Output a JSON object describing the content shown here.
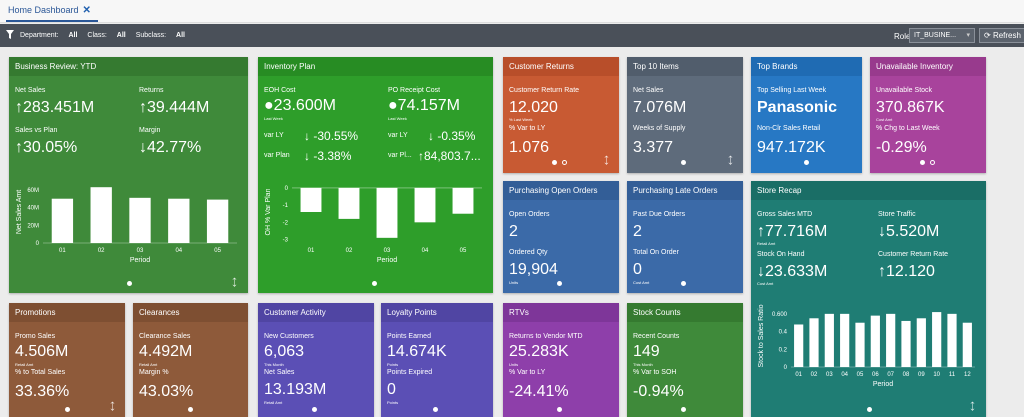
{
  "tabs": {
    "home": "Home Dashboard",
    "close": "✕"
  },
  "filters": {
    "department_label": "Department:",
    "department_value": "All",
    "class_label": "Class:",
    "class_value": "All",
    "subclass_label": "Subclass:",
    "subclass_value": "All",
    "role_label": "Role",
    "role_value": "IT_BUSINE...",
    "refresh_label": "Refresh"
  },
  "colors": {
    "green_dark": "#3f8a3a",
    "green_bright": "#2e9e2a",
    "orange": "#c85a33",
    "slate": "#5e6b7b",
    "blue": "#2778c4",
    "magenta": "#a8439c",
    "navy": "#3b6aa8",
    "teal": "#1f7d74",
    "brown": "#8e5a3a",
    "indigo": "#5b4fb5",
    "purple": "#8e3faa"
  },
  "business_review": {
    "title": "Business Review: YTD",
    "net_sales_label": "Net Sales",
    "net_sales_value": "283.451M",
    "returns_label": "Returns",
    "returns_value": "39.444M",
    "sales_vs_plan_label": "Sales vs Plan",
    "sales_vs_plan_value": "30.05%",
    "margin_label": "Margin",
    "margin_value": "42.77%"
  },
  "inventory_plan": {
    "title": "Inventory Plan",
    "eoh_label": "EOH Cost",
    "eoh_value": "23.600M",
    "eoh_sub": "Last Week",
    "po_label": "PO Receipt Cost",
    "po_value": "74.157M",
    "po_sub": "Last Week",
    "varly_label": "var LY",
    "varly_value": "-30.55%",
    "varly2_label": "var LY",
    "varly2_value": "-0.35%",
    "varplan_label": "var Plan",
    "varplan_value": "-3.38%",
    "varpl2_label": "var Pl...",
    "varpl2_value": "84,803.7..."
  },
  "customer_returns": {
    "title": "Customer Returns",
    "rate_label": "Customer Return Rate",
    "rate_value": "12.020",
    "rate_sub": "% Last Week",
    "var_label": "% Var to LY",
    "var_value": "1.076"
  },
  "top10": {
    "title": "Top 10 Items",
    "net_sales_label": "Net Sales",
    "net_sales_value": "7.076M",
    "weeks_label": "Weeks of Supply",
    "weeks_value": "3.377"
  },
  "top_brands": {
    "title": "Top Brands",
    "top_label": "Top Selling Last Week",
    "top_value": "Panasonic",
    "nonclr_label": "Non-Clr Sales Retail",
    "nonclr_value": "947.172K"
  },
  "unavailable": {
    "title": "Unavailable Inventory",
    "stock_label": "Unavailable Stock",
    "stock_value": "370.867K",
    "stock_sub": "Cost Amt",
    "chg_label": "% Chg to Last Week",
    "chg_value": "-0.29%"
  },
  "open_orders": {
    "title": "Purchasing Open Orders",
    "open_label": "Open Orders",
    "open_value": "2",
    "qty_label": "Ordered Qty",
    "qty_value": "19,904",
    "qty_sub": "Units"
  },
  "late_orders": {
    "title": "Purchasing Late Orders",
    "past_label": "Past Due Orders",
    "past_value": "2",
    "total_label": "Total On Order",
    "total_value": "0",
    "total_sub": "Cost Amt"
  },
  "store_recap": {
    "title": "Store Recap",
    "gross_label": "Gross Sales MTD",
    "gross_value": "77.716M",
    "gross_sub": "Retail Amt",
    "traffic_label": "Store Traffic",
    "traffic_value": "5.520M",
    "soh_label": "Stock On Hand",
    "soh_value": "23.633M",
    "soh_sub": "Cost Amt",
    "crr_label": "Customer Return Rate",
    "crr_value": "12.120"
  },
  "promotions": {
    "title": "Promotions",
    "promo_label": "Promo Sales",
    "promo_value": "4.506M",
    "promo_sub": "Retail Amt",
    "pct_label": "% to Total Sales",
    "pct_value": "33.36%"
  },
  "clearances": {
    "title": "Clearances",
    "sales_label": "Clearance Sales",
    "sales_value": "4.492M",
    "sales_sub": "Retail Amt",
    "margin_label": "Margin %",
    "margin_value": "43.03%"
  },
  "customer_activity": {
    "title": "Customer Activity",
    "new_label": "New Customers",
    "new_value": "6,063",
    "new_sub": "This Month",
    "net_label": "Net Sales",
    "net_value": "13.193M",
    "net_sub": "Retail Amt"
  },
  "loyalty": {
    "title": "Loyalty Points",
    "earned_label": "Points Earned",
    "earned_value": "14.674K",
    "earned_sub": "Points",
    "expired_label": "Points Expired",
    "expired_value": "0",
    "expired_sub": "Points"
  },
  "rtvs": {
    "title": "RTVs",
    "rtv_label": "Returns to Vendor MTD",
    "rtv_value": "25.283K",
    "rtv_sub": "Units",
    "var_label": "% Var to LY",
    "var_value": "-24.41%"
  },
  "stock_counts": {
    "title": "Stock Counts",
    "recent_label": "Recent Counts",
    "recent_value": "149",
    "recent_sub": "This Month",
    "var_label": "% Var to SOH",
    "var_value": "-0.94%"
  },
  "chart_data": [
    {
      "type": "bar",
      "ylabel": "Net Sales Amt",
      "xlabel": "Period",
      "categories": [
        "01",
        "02",
        "03",
        "04",
        "05"
      ],
      "values": [
        50,
        63,
        51,
        50,
        49
      ],
      "ylim": [
        0,
        70
      ],
      "yticks": [
        "0",
        "20M",
        "40M",
        "60M"
      ],
      "grid": false
    },
    {
      "type": "bar",
      "ylabel": "OH % Var Plan",
      "xlabel": "Period",
      "categories": [
        "01",
        "02",
        "03",
        "04",
        "05"
      ],
      "values": [
        -1.4,
        -1.8,
        -2.9,
        -2.0,
        -1.5
      ],
      "ylim": [
        -3.2,
        0.4
      ],
      "yticks": [
        "0",
        "-1",
        "-2",
        "-3"
      ],
      "grid": false
    },
    {
      "type": "bar",
      "ylabel": "Stock to Sales Ratio",
      "xlabel": "Period",
      "categories": [
        "01",
        "02",
        "03",
        "04",
        "05",
        "06",
        "07",
        "08",
        "09",
        "10",
        "11",
        "12"
      ],
      "values": [
        0.48,
        0.55,
        0.6,
        0.6,
        0.5,
        0.58,
        0.6,
        0.52,
        0.55,
        0.62,
        0.6,
        0.5
      ],
      "ylim": [
        0,
        0.7
      ],
      "yticks": [
        "0",
        "0.2",
        "0.4",
        "0.600"
      ],
      "grid": false
    }
  ]
}
